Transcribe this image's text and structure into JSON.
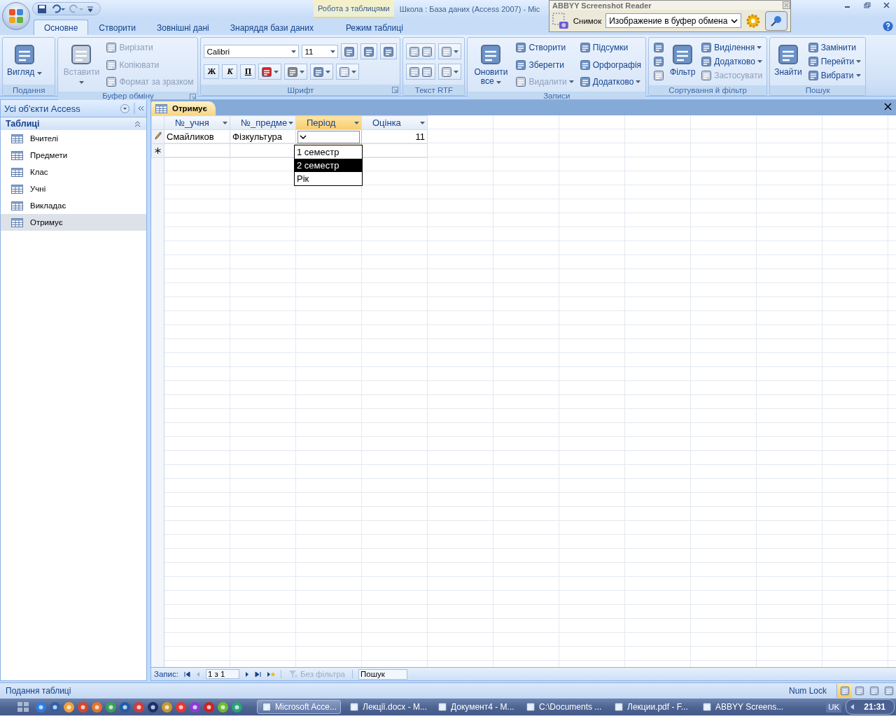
{
  "window": {
    "title": "Школа : База даних (Access 2007) - Mic",
    "context_tab": "Робота з таблицями"
  },
  "overlay": {
    "title": "ABBYY Screenshot Reader",
    "capture_label": "Снимок",
    "mode": "Изображение в буфер обмена"
  },
  "ribbon": {
    "tabs": [
      {
        "label": "Основне",
        "selected": true
      },
      {
        "label": "Створити",
        "selected": false
      },
      {
        "label": "Зовнішні дані",
        "selected": false
      },
      {
        "label": "Знаряддя бази даних",
        "selected": false
      },
      {
        "label": "Режим таблиці",
        "selected": false
      }
    ],
    "groups": [
      {
        "label": "Подання",
        "kind": "commands",
        "launcher": false,
        "columns": [
          [
            {
              "label": "Вигляд",
              "kind": "large",
              "disabled": false,
              "dropdown": true
            }
          ]
        ]
      },
      {
        "label": "Буфер обміну",
        "kind": "commands",
        "launcher": true,
        "columns": [
          [
            {
              "label": "Вставити",
              "kind": "large",
              "disabled": true,
              "dropdown": true
            }
          ],
          [
            {
              "label": "Вирізати",
              "kind": "small",
              "disabled": true,
              "dropdown": false
            },
            {
              "label": "Копіювати",
              "kind": "small",
              "disabled": true,
              "dropdown": false
            },
            {
              "label": "Формат за зразком",
              "kind": "small",
              "disabled": true,
              "dropdown": false
            }
          ]
        ]
      },
      {
        "label": "Шрифт",
        "kind": "font",
        "launcher": true,
        "font": "Calibri",
        "font_size": "11",
        "styles": [
          "Ж",
          "К",
          "П"
        ]
      },
      {
        "label": "Текст RTF",
        "kind": "rtf",
        "launcher": false
      },
      {
        "label": "Записи",
        "kind": "commands",
        "launcher": false,
        "columns": [
          [
            {
              "label": "Оновити все",
              "kind": "large",
              "disabled": false,
              "dropdown": true
            }
          ],
          [
            {
              "label": "Створити",
              "kind": "small",
              "disabled": false,
              "dropdown": false
            },
            {
              "label": "Зберегти",
              "kind": "small",
              "disabled": false,
              "dropdown": false
            },
            {
              "label": "Видалити",
              "kind": "small",
              "disabled": true,
              "dropdown": true
            }
          ],
          [
            {
              "label": "Підсумки",
              "kind": "small",
              "disabled": false,
              "dropdown": false
            },
            {
              "label": "Орфографія",
              "kind": "small",
              "disabled": false,
              "dropdown": false
            },
            {
              "label": "Додатково",
              "kind": "small",
              "disabled": false,
              "dropdown": true
            }
          ]
        ]
      },
      {
        "label": "Сортування й фільтр",
        "kind": "commands",
        "launcher": false,
        "columns": [
          [
            {
              "kind": "icon",
              "disabled": false,
              "dropdown": false
            },
            {
              "kind": "icon",
              "disabled": false,
              "dropdown": false
            },
            {
              "kind": "icon",
              "disabled": true,
              "dropdown": false
            }
          ],
          [
            {
              "label": "Фільтр",
              "kind": "large",
              "disabled": false,
              "dropdown": false
            }
          ],
          [
            {
              "label": "Виділення",
              "kind": "small",
              "disabled": false,
              "dropdown": true
            },
            {
              "label": "Додатково",
              "kind": "small",
              "disabled": false,
              "dropdown": true
            },
            {
              "label": "Застосувати",
              "kind": "small",
              "disabled": true,
              "dropdown": false
            }
          ]
        ]
      },
      {
        "label": "Пошук",
        "kind": "commands",
        "launcher": false,
        "columns": [
          [
            {
              "label": "Знайти",
              "kind": "large",
              "disabled": false,
              "dropdown": false
            }
          ],
          [
            {
              "label": "Замінити",
              "kind": "small",
              "disabled": false,
              "dropdown": false
            },
            {
              "label": "Перейти",
              "kind": "small",
              "disabled": false,
              "dropdown": true
            },
            {
              "label": "Вибрати",
              "kind": "small",
              "disabled": false,
              "dropdown": true
            }
          ]
        ]
      }
    ]
  },
  "nav": {
    "title": "Усі об'єкти Access",
    "section": "Таблиці",
    "items": [
      {
        "label": "Вчителі",
        "selected": false
      },
      {
        "label": "Предмети",
        "selected": false
      },
      {
        "label": "Клас",
        "selected": false
      },
      {
        "label": "Учні",
        "selected": false
      },
      {
        "label": "Викладає",
        "selected": false
      },
      {
        "label": "Отримує",
        "selected": true
      }
    ]
  },
  "document": {
    "tab": "Отримує"
  },
  "datasheet": {
    "columns": [
      {
        "label": "№_учня",
        "selected": false,
        "kind": "text"
      },
      {
        "label": "№_предме",
        "selected": false,
        "kind": "text"
      },
      {
        "label": "Період",
        "selected": true,
        "kind": "text"
      },
      {
        "label": "Оцінка",
        "selected": false,
        "kind": "number"
      }
    ],
    "rows": [
      {
        "cells": [
          "Смайликов",
          "Фізкультура",
          "",
          "11"
        ],
        "editing": true
      }
    ],
    "dropdown": {
      "options": [
        {
          "label": "1 семестр",
          "selected": false
        },
        {
          "label": "2 семестр",
          "selected": true
        },
        {
          "label": "Рік",
          "selected": false
        }
      ]
    }
  },
  "record_nav": {
    "label": "Запис:",
    "position": "1 з 1",
    "filter": "Без фільтра",
    "search": "Пошук"
  },
  "status_bar": {
    "text": "Подання таблиці",
    "num_lock": "Num Lock",
    "views": [
      {
        "selected": true
      },
      {
        "selected": false
      },
      {
        "selected": false
      },
      {
        "selected": false
      }
    ]
  },
  "taskbar": {
    "tasks": [
      {
        "label": "Microsoft Acce...",
        "active": true
      },
      {
        "label": "Лекції.docx - M...",
        "active": false
      },
      {
        "label": "Документ4 - M...",
        "active": false
      },
      {
        "label": "C:\\Documents ...",
        "active": false
      },
      {
        "label": "Лекции.pdf - F...",
        "active": false
      },
      {
        "label": "ABBYY Screens...",
        "active": false
      }
    ],
    "language": "UK",
    "clock": "21:31"
  }
}
